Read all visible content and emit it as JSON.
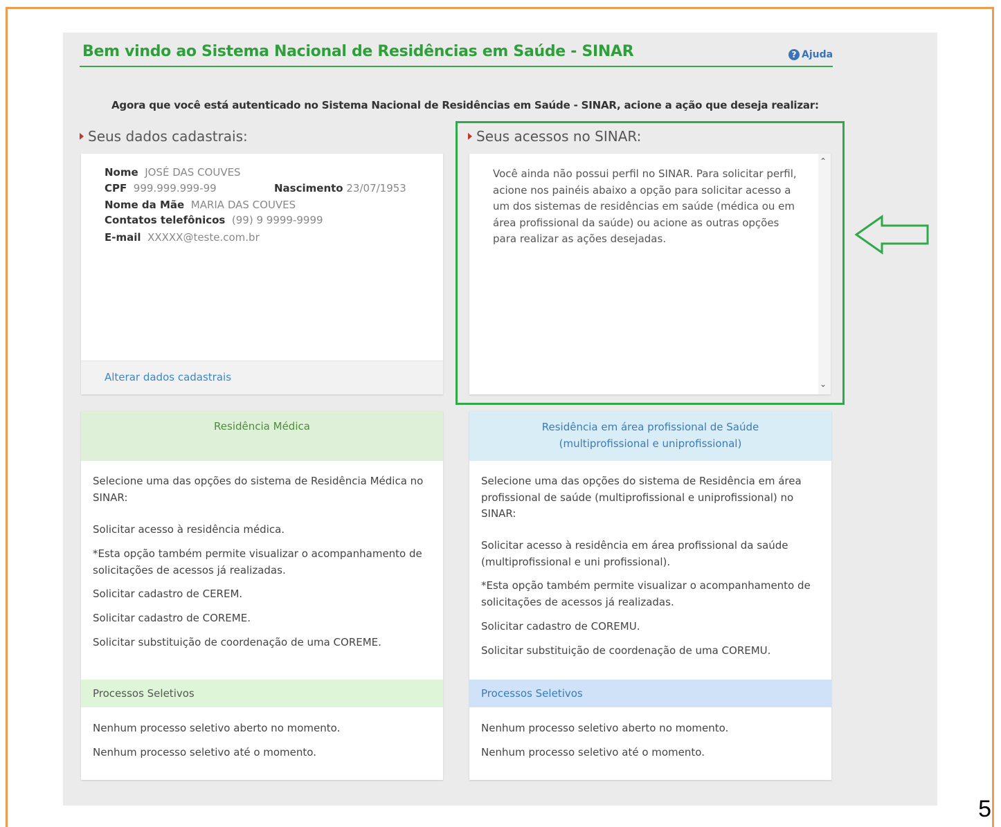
{
  "header": {
    "title": "Bem vindo ao Sistema Nacional de Residências em Saúde - SINAR",
    "help_label": "Ajuda"
  },
  "intro": "Agora que você está autenticado no Sistema Nacional de Residências em Saúde - SINAR, acione a ação que deseja realizar:",
  "registration": {
    "heading": "Seus dados cadastrais:",
    "fields": {
      "nome_label": "Nome",
      "nome_value": "JOSÉ DAS COUVES",
      "cpf_label": "CPF",
      "cpf_value": "999.999.999-99",
      "nasc_label": "Nascimento",
      "nasc_value": "23/07/1953",
      "mae_label": "Nome da Mãe",
      "mae_value": "MARIA DAS COUVES",
      "tel_label": "Contatos telefônicos",
      "tel_value": "(99) 9 9999-9999",
      "email_label": "E-mail",
      "email_value": "XXXXX@teste.com.br"
    },
    "edit_link": "Alterar dados cadastrais"
  },
  "access": {
    "heading": "Seus acessos no SINAR:",
    "text": "Você ainda não possui perfil no SINAR. Para solicitar perfil, acione nos painéis abaixo a opção para solicitar acesso a um dos sistemas de residências em saúde (médica ou em área profissional da saúde) ou acione as outras opções para realizar as ações desejadas."
  },
  "medica": {
    "title": "Residência Médica",
    "intro": "Selecione uma das opções do sistema de Residência Médica no SINAR:",
    "link_acesso": "Solicitar acesso à residência médica.",
    "note": "*Esta opção também permite visualizar o acompanhamento de solicitações de acessos já realizadas.",
    "link_cerem": "Solicitar cadastro de CEREM.",
    "link_coreme": "Solicitar cadastro de COREME.",
    "link_subst": "Solicitar substituição de coordenação de uma COREME.",
    "proc_title": "Processos Seletivos",
    "proc_1": "Nenhum processo seletivo aberto no momento.",
    "proc_2": "Nenhum processo seletivo até o momento."
  },
  "multi": {
    "title_line1": "Residência em área profissional de Saúde",
    "title_line2": "(multiprofissional e uniprofissional)",
    "intro": "Selecione uma das opções do sistema de Residência em área profissional de saúde (multiprofissional e uniprofissional) no SINAR:",
    "link_acesso": "Solicitar acesso à residência em área profissional da saúde (multiprofissional e uni profissional).",
    "note": "*Esta opção também permite visualizar o acompanhamento de solicitações de acessos já realizadas.",
    "link_coremu": "Solicitar cadastro de COREMU.",
    "link_subst": "Solicitar substituição de coordenação de uma COREMU.",
    "proc_title": "Processos Seletivos",
    "proc_1": "Nenhum processo seletivo aberto no momento.",
    "proc_2": "Nenhum processo seletivo até o momento."
  },
  "page_number": "5",
  "colors": {
    "title_green": "#2ea03a",
    "link_blue": "#3a87c6",
    "highlight_green": "#31a84a",
    "frame_orange": "#f09a4e",
    "medica_header": "#dff0d8",
    "multi_header": "#d9edf7"
  }
}
